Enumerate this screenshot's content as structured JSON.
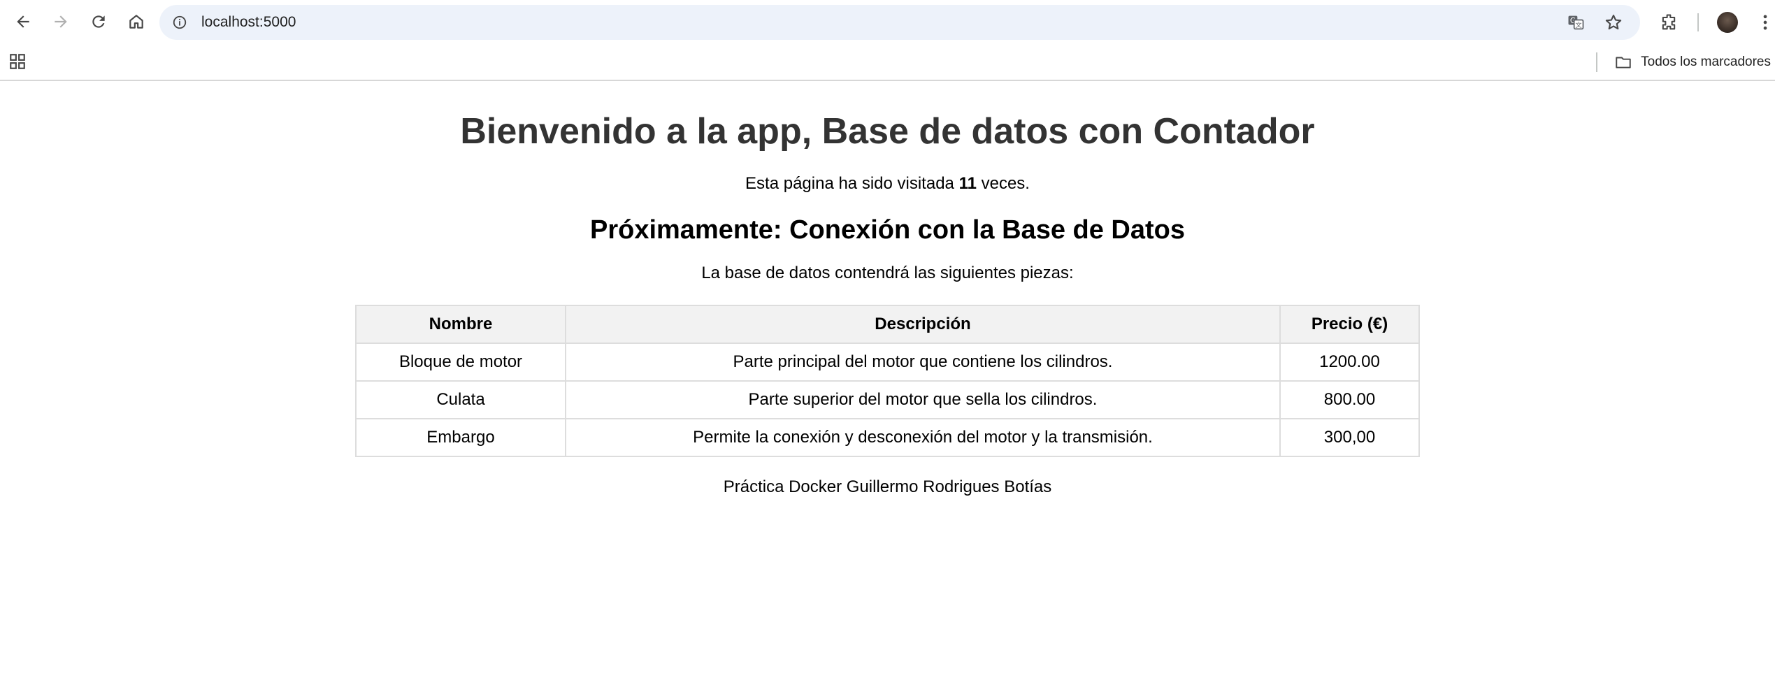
{
  "browser": {
    "url": "localhost:5000",
    "bookmarks_folder": "Todos los marcadores"
  },
  "page": {
    "title": "Bienvenido a la app, Base de datos con Contador",
    "visits_prefix": "Esta página ha sido visitada ",
    "visits_count": "11",
    "visits_suffix": " veces.",
    "subtitle": "Próximamente: Conexión con la Base de Datos",
    "intro": "La base de datos contendrá las siguientes piezas:",
    "table": {
      "headers": [
        "Nombre",
        "Descripción",
        "Precio (€)"
      ],
      "rows": [
        [
          "Bloque de motor",
          "Parte principal del motor que contiene los cilindros.",
          "1200.00"
        ],
        [
          "Culata",
          "Parte superior del motor que sella los cilindros.",
          "800.00"
        ],
        [
          "Embargo",
          "Permite la conexión y desconexión del motor y la transmisión.",
          "300,00"
        ]
      ]
    },
    "footer": "Práctica Docker Guillermo Rodrigues Botías"
  }
}
